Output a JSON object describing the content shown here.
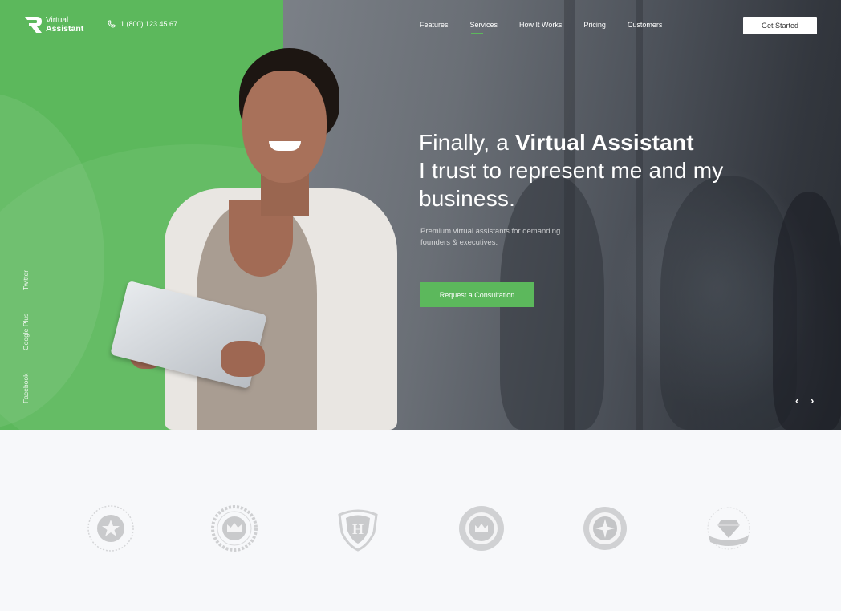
{
  "brand": {
    "logo_line1": "Virtual",
    "logo_line2": "Assistant",
    "logo_icon": "r-logo-icon",
    "phone_icon": "phone-icon",
    "phone": "1 (800) 123 45 67",
    "accent_color": "#5cb85c"
  },
  "nav": {
    "items": [
      {
        "label": "Features",
        "active": false
      },
      {
        "label": "Services",
        "active": true
      },
      {
        "label": "How It Works",
        "active": false
      },
      {
        "label": "Pricing",
        "active": false
      },
      {
        "label": "Customers",
        "active": false
      }
    ],
    "cta_label": "Get Started"
  },
  "hero": {
    "headline_prefix": "Finally, a ",
    "headline_bold": "Virtual Assistant",
    "headline_rest": "I trust to represent me and my business.",
    "subline": "Premium virtual assistants for demanding founders & executives.",
    "cta_label": "Request a Consultation",
    "prev_icon": "chevron-left-icon",
    "next_icon": "chevron-right-icon"
  },
  "social": {
    "items": [
      "Twitter",
      "Google Plus",
      "Facebook"
    ]
  },
  "badges": {
    "items": [
      {
        "icon": "star-badge-icon"
      },
      {
        "icon": "crown-laurel-badge-icon"
      },
      {
        "icon": "h-shield-badge-icon"
      },
      {
        "icon": "crown-ribbon-badge-icon"
      },
      {
        "icon": "compass-badge-icon"
      },
      {
        "icon": "diamond-badge-icon"
      }
    ]
  }
}
